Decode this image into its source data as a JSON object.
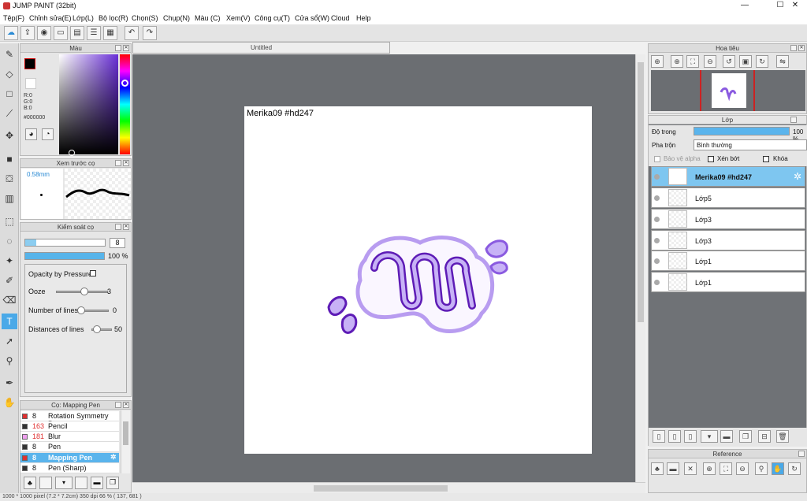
{
  "app": {
    "title": "JUMP PAINT (32bit)"
  },
  "window_controls": {
    "min": "—",
    "max": "☐",
    "close": "✕"
  },
  "menu": [
    "Tệp(F)",
    "Chỉnh sửa(E)",
    "Lớp(L)",
    "Bộ lọc(R)",
    "Chọn(S)",
    "Chụp(N)",
    "Màu (C)",
    "Xem(V)",
    "Công cụ(T)",
    "Cửa sổ(W)",
    "Cloud",
    "Help"
  ],
  "toolbar": [
    "cloud-icon",
    "export-icon",
    "comment-icon",
    "message-icon",
    "page-icon",
    "list-icon",
    "grid-icon",
    "undo-icon",
    "redo-icon"
  ],
  "color_panel": {
    "title": "Màu",
    "r": "R:0",
    "g": "G:0",
    "b": "B:0",
    "hex": "#000000",
    "fg": "#000000",
    "accent": "#6a2fd8"
  },
  "brush_preview": {
    "title": "Xem trước cọ",
    "size": "0.58mm"
  },
  "brush_control": {
    "title": "Kiểm soát cọ",
    "size_value": "8",
    "opacity_value": "100 %",
    "opacity_by_pressure": "Opacity by Pressure",
    "ooze_label": "Ooze",
    "ooze_value": "3",
    "lines_label": "Number of lines",
    "lines_value": "0",
    "dist_label": "Distances of lines",
    "dist_value": "50"
  },
  "brush_list": {
    "title": "Cọ: Mapping Pen",
    "items": [
      {
        "num": "8",
        "name": "Rotation Symmetry Pen",
        "color": "#e03030",
        "red_num": false
      },
      {
        "num": "163",
        "name": "Pencil",
        "color": "#333333",
        "red_num": true
      },
      {
        "num": "181",
        "name": "Blur",
        "color": "#f0a0f0",
        "red_num": true
      },
      {
        "num": "8",
        "name": "Pen",
        "color": "#333333",
        "red_num": false
      },
      {
        "num": "8",
        "name": "Mapping Pen",
        "color": "#e03030",
        "red_num": false,
        "selected": true
      },
      {
        "num": "8",
        "name": "Pen (Sharp)",
        "color": "#333333",
        "red_num": false
      }
    ]
  },
  "document": {
    "tab": "Untitled",
    "signature": "Merika09  #hd247"
  },
  "navigator": {
    "title": "Hoa tiêu"
  },
  "layer_panel": {
    "title": "Lớp",
    "opacity_label": "Độ trong",
    "opacity_value": "100 %",
    "blend_label": "Pha trộn",
    "blend_value": "Bình thường",
    "protect_alpha": "Bảo vệ alpha",
    "clip": "Xén bớt",
    "lock": "Khóa",
    "layers": [
      {
        "name": "Merika09  #hd247",
        "selected": true
      },
      {
        "name": "Lớp5"
      },
      {
        "name": "Lớp3"
      },
      {
        "name": "Lớp3"
      },
      {
        "name": "Lớp1"
      },
      {
        "name": "Lớp1"
      }
    ]
  },
  "reference": {
    "title": "Reference"
  },
  "status": {
    "text": "1000 * 1000 pixel   (7.2 * 7.2cm)   350 dpi   66 %   ( 137, 681 )"
  }
}
